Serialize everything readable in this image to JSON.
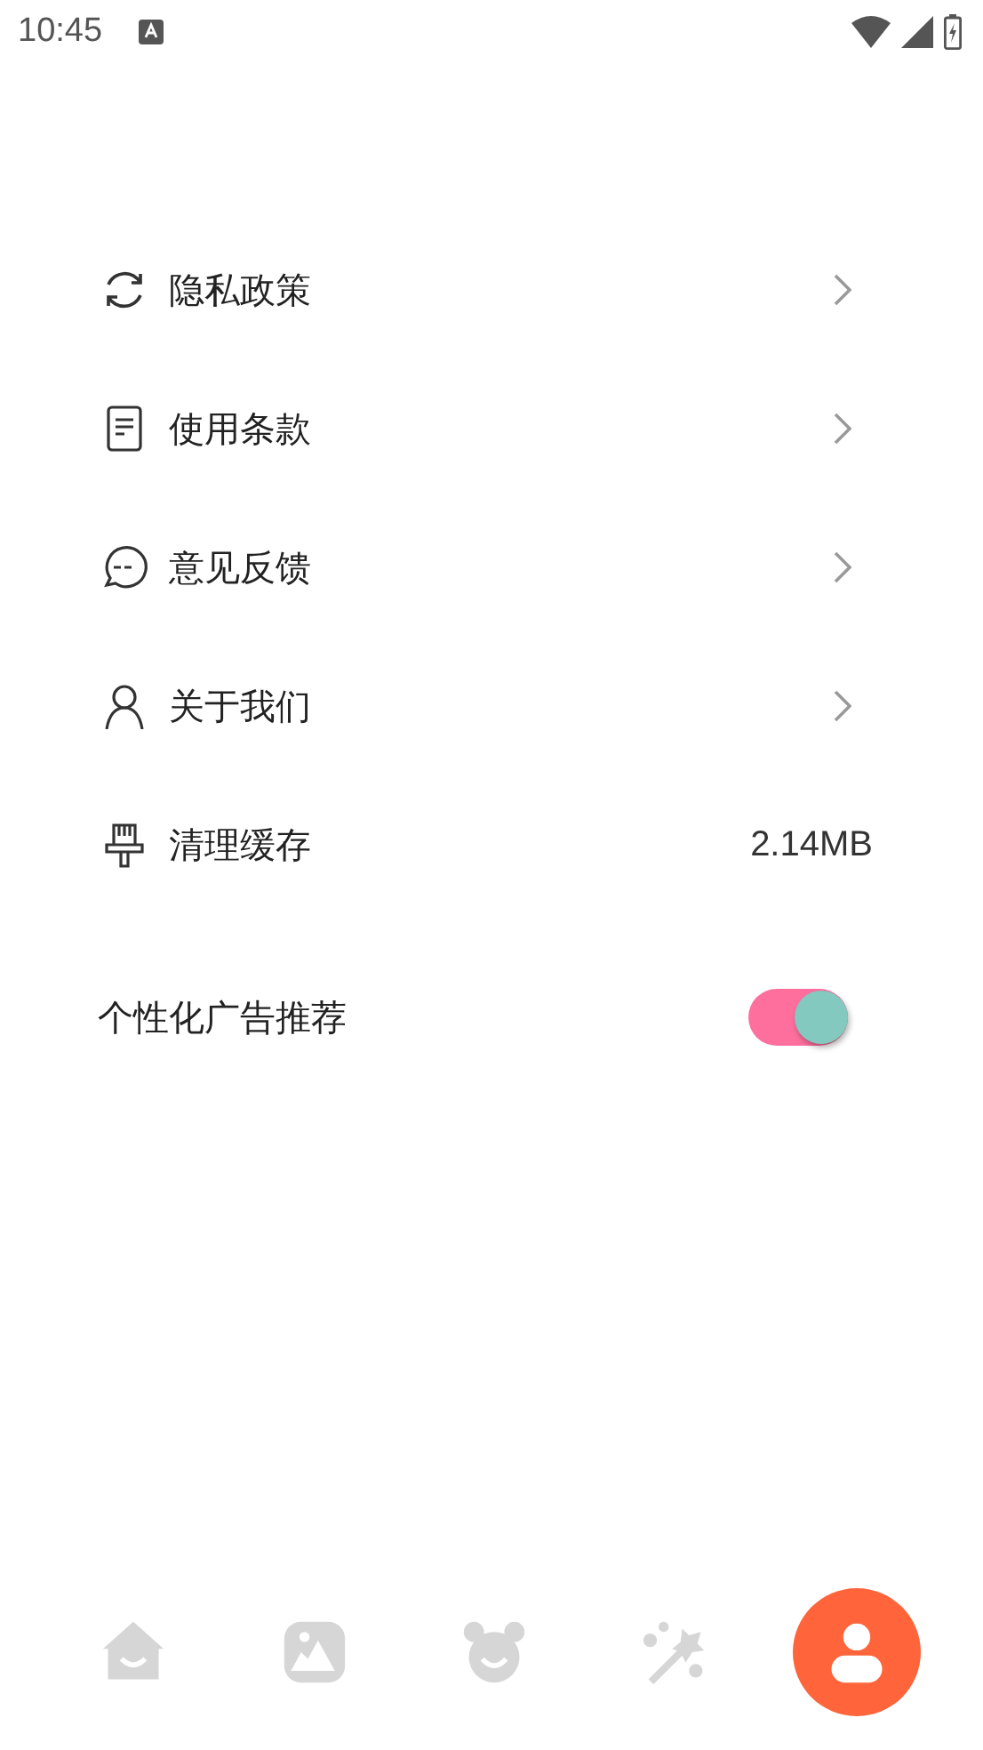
{
  "status_bar": {
    "time": "10:45"
  },
  "menu": [
    {
      "kind": "link",
      "label": "隐私政策"
    },
    {
      "kind": "link",
      "label": "使用条款"
    },
    {
      "kind": "link",
      "label": "意见反馈"
    },
    {
      "kind": "link",
      "label": "关于我们"
    },
    {
      "kind": "value",
      "label": "清理缓存",
      "value": "2.14MB"
    }
  ],
  "ad_setting": {
    "label": "个性化广告推荐",
    "on": true
  },
  "bottom_nav": [
    {
      "selected": false
    },
    {
      "selected": false
    },
    {
      "selected": false
    },
    {
      "selected": false
    },
    {
      "selected": true
    }
  ]
}
